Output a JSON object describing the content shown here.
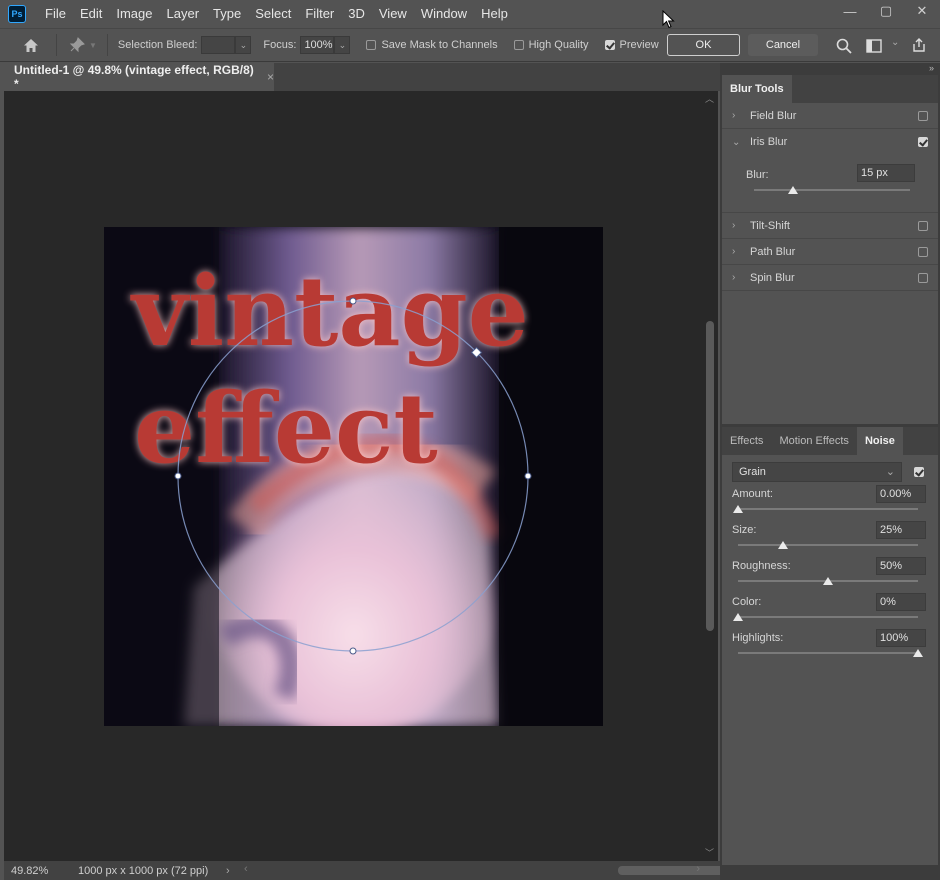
{
  "menubar": {
    "logo": "Ps",
    "items": [
      "File",
      "Edit",
      "Image",
      "Layer",
      "Type",
      "Select",
      "Filter",
      "3D",
      "View",
      "Window",
      "Help"
    ],
    "window_controls": [
      "—",
      "▢",
      "✕"
    ]
  },
  "options": {
    "selection_bleed_label": "Selection Bleed:",
    "selection_bleed_value": "",
    "focus_label": "Focus:",
    "focus_value": "100%",
    "save_mask_label": "Save Mask to Channels",
    "save_mask_checked": false,
    "high_quality_label": "High Quality",
    "high_quality_checked": false,
    "preview_label": "Preview",
    "preview_checked": true,
    "ok_label": "OK",
    "cancel_label": "Cancel"
  },
  "document": {
    "tab_title": "Untitled-1 @ 49.8% (vintage effect, RGB/8) *",
    "close_glyph": "×",
    "zoom": "49.82%",
    "doc_info": "1000 px x 1000 px (72 ppi)",
    "art_line1": "vintage",
    "art_line2": "effect"
  },
  "blur_tools": {
    "tab_label": "Blur Tools",
    "items": [
      {
        "label": "Field Blur",
        "checked": false,
        "expanded": false
      },
      {
        "label": "Iris Blur",
        "checked": true,
        "expanded": true
      },
      {
        "label": "Tilt-Shift",
        "checked": false,
        "expanded": false
      },
      {
        "label": "Path Blur",
        "checked": false,
        "expanded": false
      },
      {
        "label": "Spin Blur",
        "checked": false,
        "expanded": false
      }
    ],
    "blur_label": "Blur:",
    "blur_value": "15 px",
    "blur_level": 0.25
  },
  "effects_panel": {
    "tabs": [
      "Effects",
      "Motion Effects",
      "Noise"
    ],
    "active_tab": "Noise",
    "noise_type": "Grain",
    "noise_enabled": true,
    "sliders": [
      {
        "label": "Amount:",
        "value": "0.00%",
        "level": 0.0
      },
      {
        "label": "Size:",
        "value": "25%",
        "level": 0.25
      },
      {
        "label": "Roughness:",
        "value": "50%",
        "level": 0.5
      },
      {
        "label": "Color:",
        "value": "0%",
        "level": 0.0
      },
      {
        "label": "Highlights:",
        "value": "100%",
        "level": 1.0
      }
    ]
  },
  "colors": {
    "app_bg": "#535353",
    "canvas_bg": "#282828",
    "accent": "#31a8ff"
  }
}
